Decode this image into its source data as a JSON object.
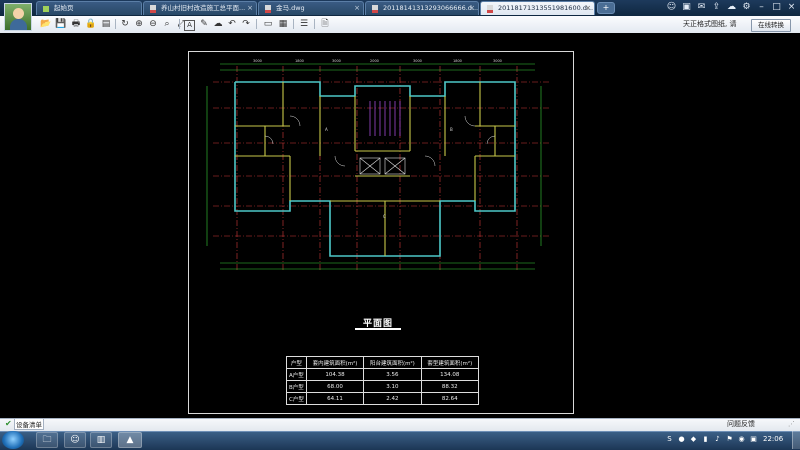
{
  "tabs": [
    {
      "label": "起始页",
      "active": false
    },
    {
      "label": "养山村旧村改造施工总平面...",
      "active": false
    },
    {
      "label": "金马.dwg",
      "active": false
    },
    {
      "label": "20118141313293066666.d...",
      "active": false
    },
    {
      "label": "20118171313551981600.d...",
      "active": true
    }
  ],
  "toolbar": {
    "hint": "天正格式图纸, 请",
    "convert_label": "在线转换",
    "text_tool_label": "A"
  },
  "drawing": {
    "title": "平面图",
    "area_table": {
      "headers": [
        "户型",
        "套内建筑面积(m²)",
        "阳台建筑面积(m²)",
        "套型建筑面积(m²)"
      ],
      "rows": [
        [
          "A户型",
          "104.38",
          "3.56",
          "134.08"
        ],
        [
          "B户型",
          "68.00",
          "3.10",
          "88.32"
        ],
        [
          "C户型",
          "64.11",
          "2.42",
          "82.64"
        ]
      ]
    },
    "top_dims": [
      "3000",
      "1800",
      "3000",
      "2000",
      "3000",
      "1800",
      "3000"
    ],
    "bottom_dims": [
      "3300",
      "1200",
      "3300",
      "3600",
      "3300",
      "1200",
      "3300"
    ],
    "room_labels": [
      "A",
      "B",
      "C"
    ],
    "colors": {
      "wall": "#c8c84a",
      "wall_outer": "#4ec8c8",
      "grid": "#d23a3a",
      "dim": "#3ad23a",
      "stair": "#a04ad2"
    }
  },
  "statusbar": {
    "device_list_label": "设备清单",
    "feedback_label": "问题反馈"
  },
  "taskbar": {
    "clock": "22:06"
  }
}
